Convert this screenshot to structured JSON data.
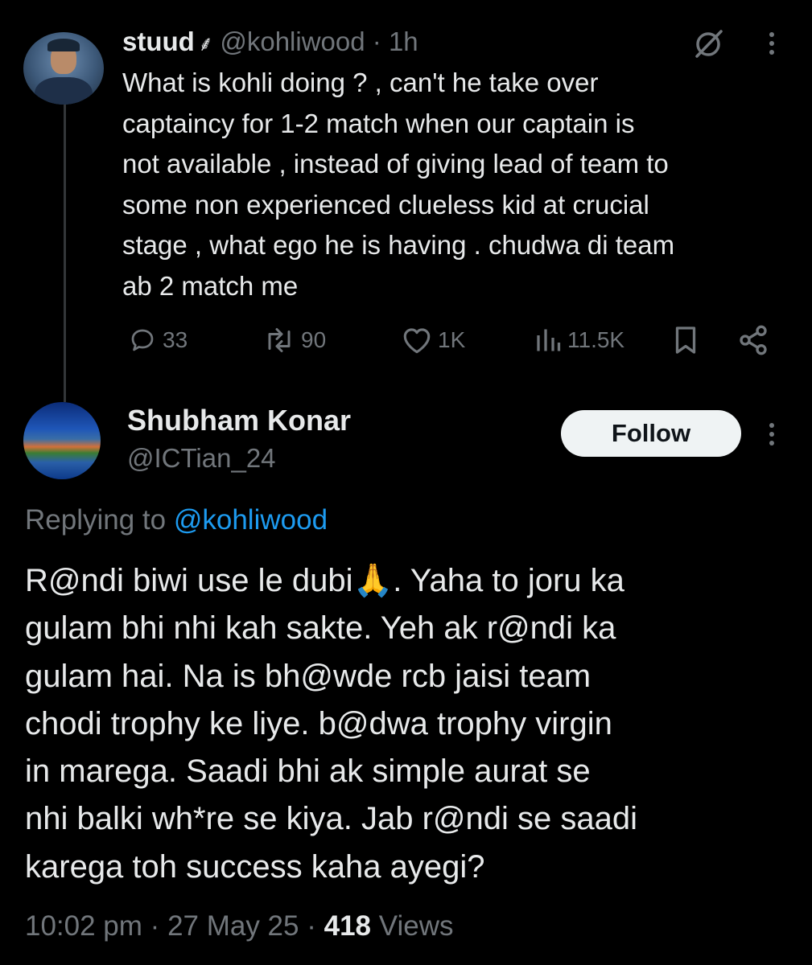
{
  "tweet": {
    "author_name": "stuud",
    "author_badge": "⸙",
    "handle": "@kohliwood",
    "separator": "·",
    "time": "1h",
    "text": "What is kohli doing ? , can't he take over\ncaptaincy for 1-2 match when our captain is\nnot available , instead of giving lead of team to\nsome non experienced clueless kid at crucial\nstage , what ego he is having . chudwa di team\nab 2 match me",
    "replies": "33",
    "reposts": "90",
    "likes": "1K",
    "views": "11.5K"
  },
  "reply": {
    "author_name": "Shubham Konar",
    "handle": "@ICTian_24",
    "follow_label": "Follow",
    "replying_prefix": "Replying to",
    "replying_to": "@kohliwood",
    "text": "R@ndi biwi use le dubi🙏. Yaha to joru ka\ngulam bhi nhi kah sakte. Yeh ak r@ndi ka\ngulam hai. Na is bh@wde rcb jaisi team\nchodi trophy ke liye. b@dwa trophy virgin\nin marega. Saadi bhi ak simple aurat se\nnhi balki wh*re se kiya. Jab r@ndi se saadi\nkarega toh success kaha ayegi?",
    "time": "10:02 pm",
    "date": "27 May 25",
    "separator": "·",
    "views_count": "418",
    "views_label": "Views"
  },
  "icons": {
    "reply": "reply-icon",
    "repost": "repost-icon",
    "like": "heart-icon",
    "views": "views-icon",
    "bookmark": "bookmark-icon",
    "share": "share-icon",
    "grok": "grok-icon",
    "more": "more-icon"
  },
  "colors": {
    "background": "#000000",
    "text": "#e7e9ea",
    "muted": "#71767b",
    "link": "#1d9bf0",
    "button_bg": "#eff3f4"
  }
}
